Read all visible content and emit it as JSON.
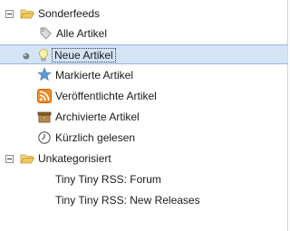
{
  "tree": {
    "groups": [
      {
        "label": "Sonderfeeds",
        "items": [
          {
            "label": "Alle Artikel",
            "icon": "tag-icon"
          },
          {
            "label": "Neue Artikel",
            "icon": "lightbulb-icon",
            "selected": true
          },
          {
            "label": "Markierte Artikel",
            "icon": "star-icon"
          },
          {
            "label": "Veröffentlichte Artikel",
            "icon": "rss-icon"
          },
          {
            "label": "Archivierte Artikel",
            "icon": "archive-box-icon"
          },
          {
            "label": "Kürzlich gelesen",
            "icon": "clock-icon"
          }
        ]
      },
      {
        "label": "Unkategorisiert",
        "items": [
          {
            "label": "Tiny Tiny RSS: Forum"
          },
          {
            "label": "Tiny Tiny RSS: New Releases"
          }
        ]
      }
    ]
  },
  "colors": {
    "selection_bg": "#d3e4f6",
    "folder": "#f0c75a",
    "rss": "#f08a24",
    "star": "#5b9bd5"
  }
}
